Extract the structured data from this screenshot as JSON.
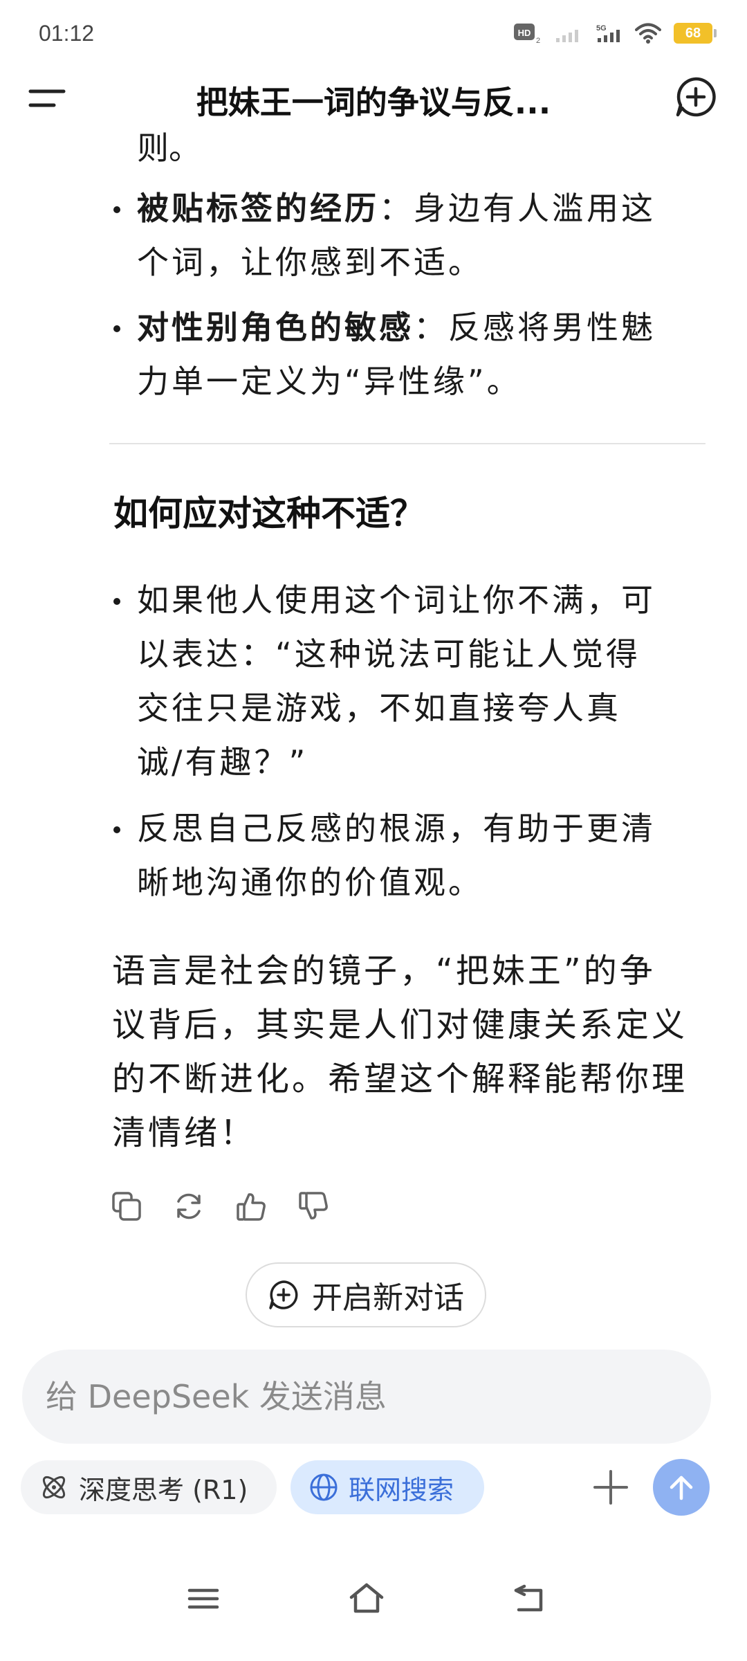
{
  "status_bar": {
    "time": "01:12",
    "network": "5G",
    "battery": "68"
  },
  "header": {
    "title": "把妹王一词的争议与反..."
  },
  "content": {
    "cut_line": "则。",
    "bullets_top": [
      {
        "bold": "被贴标签的经历",
        "colon": "：",
        "lines": [
          "身边有人滥用这",
          "个词，让你感到不适。"
        ]
      },
      {
        "bold": "对性别角色的敏感",
        "colon": "：",
        "lines": [
          "反感将男性魅",
          "力单一定义为“异性缘”。"
        ]
      }
    ],
    "section_heading": "如何应对这种不适？",
    "bullets_bottom": [
      {
        "lines": [
          "如果他人使用这个词让你不满，可",
          "以表达：“这种说法可能让人觉得",
          "交往只是游戏，不如直接夸人真",
          "诚/有趣？”"
        ]
      },
      {
        "lines": [
          "反思自己反感的根源，有助于更清",
          "晰地沟通你的价值观。"
        ]
      }
    ],
    "closing": [
      "语言是社会的镜子，“把妹王”的争",
      "议背后，其实是人们对健康关系定义",
      "的不断进化。希望这个解释能帮你理",
      "清情绪！"
    ]
  },
  "new_chat_button": "开启新对话",
  "input": {
    "placeholder": "给 DeepSeek 发送消息"
  },
  "chips": {
    "deep_think": "深度思考 (R1)",
    "web_search": "联网搜索"
  },
  "colors": {
    "accent": "#3b6fd9",
    "send_button": "#8fb2f2",
    "battery": "#f2c029"
  }
}
